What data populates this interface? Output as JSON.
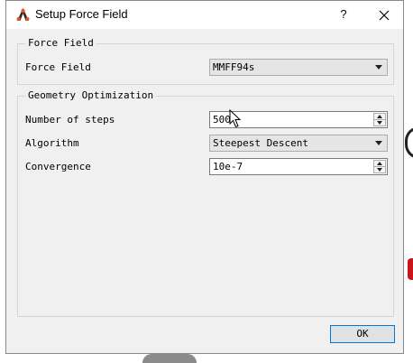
{
  "window": {
    "title": "Setup Force Field",
    "help_label": "?"
  },
  "force_field_group": {
    "title": "Force Field",
    "field_label": "Force Field",
    "field_value": "MMFF94s"
  },
  "geometry_group": {
    "title": "Geometry Optimization",
    "steps_label": "Number of steps",
    "steps_value": "500",
    "algorithm_label": "Algorithm",
    "algorithm_value": "Steepest Descent",
    "convergence_label": "Convergence",
    "convergence_value": "10e-7"
  },
  "footer": {
    "ok_label": "OK"
  },
  "icons": {
    "app": "avogadro-app-icon",
    "close": "close-icon",
    "combo_arrow": "chevron-down-icon",
    "spin_up": "spin-up-icon",
    "spin_down": "spin-down-icon",
    "cursor": "mouse-cursor-icon"
  },
  "colors": {
    "dialog_bg": "#f0f0f0",
    "titlebar_bg": "#ffffff",
    "ok_border": "#0078d7"
  }
}
